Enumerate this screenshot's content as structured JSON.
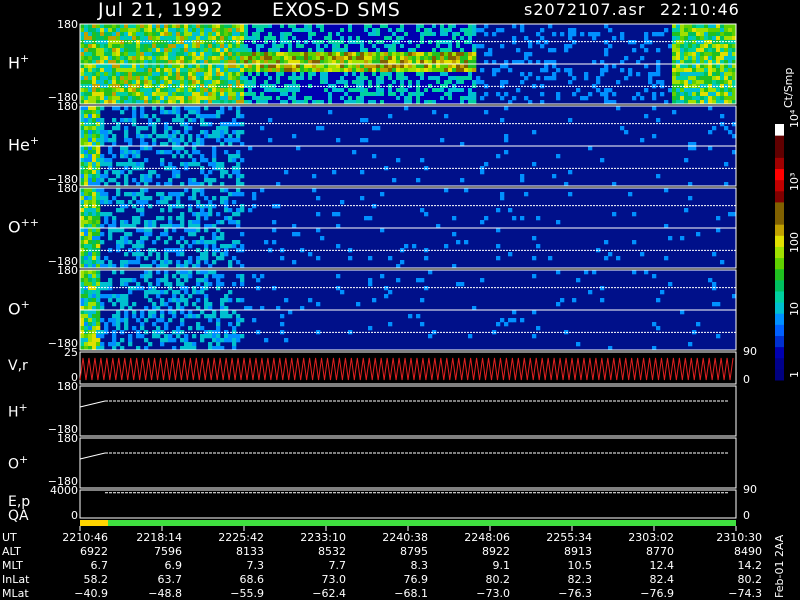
{
  "header": {
    "date": "Jul 21, 1992",
    "mission": "EXOS-D SMS",
    "file": "s2072107.asr",
    "time": "22:10:46"
  },
  "panels": [
    {
      "ion": "H",
      "charge": "+",
      "top": "180",
      "bottom": "−180"
    },
    {
      "ion": "He",
      "charge": "+",
      "top": "180",
      "bottom": "−180"
    },
    {
      "ion": "O",
      "charge": "++",
      "top": "180",
      "bottom": "−180"
    },
    {
      "ion": "O",
      "charge": "+",
      "top": "180",
      "bottom": "−180"
    },
    {
      "ion": "V",
      "charge": ",r",
      "top": "25",
      "bottom": "0",
      "right_top": "90",
      "right_bottom": "0"
    },
    {
      "ion": "H",
      "charge": "+",
      "top": "180",
      "bottom": "−180"
    },
    {
      "ion": "O",
      "charge": "+",
      "top": "180",
      "bottom": "−180"
    },
    {
      "ion": "E,p",
      "charge": "",
      "top": "4000",
      "bottom": "0",
      "right_top": "90"
    },
    {
      "ion": "QA",
      "charge": "",
      "top": "",
      "bottom": "",
      "right_top": "0"
    }
  ],
  "colorbar": {
    "label": "Ct/Smp",
    "ticks": [
      "1",
      "10",
      "100",
      "10³",
      "10⁴"
    ],
    "colors": [
      "#000080",
      "#00008b",
      "#0000b0",
      "#0030d0",
      "#0060ff",
      "#0090ff",
      "#00c0d0",
      "#00d0a0",
      "#00c060",
      "#20c020",
      "#60d000",
      "#a0e000",
      "#e0e000",
      "#c0a000",
      "#806000",
      "#806000",
      "#800000",
      "#c00000",
      "#ff0000",
      "#a00000",
      "#600000",
      "#600000",
      "#ffffff"
    ]
  },
  "footer": {
    "side_label": "Feb-01 2AA",
    "rows": [
      {
        "label": "UT",
        "values": [
          "2210:46",
          "2218:14",
          "2225:42",
          "2233:10",
          "2240:38",
          "2248:06",
          "2255:34",
          "2303:02",
          "2310:30"
        ]
      },
      {
        "label": "ALT",
        "values": [
          "6922",
          "7596",
          "8133",
          "8532",
          "8795",
          "8922",
          "8913",
          "8770",
          "8490"
        ]
      },
      {
        "label": "MLT",
        "values": [
          "6.7",
          "6.9",
          "7.3",
          "7.7",
          "8.3",
          "9.1",
          "10.5",
          "12.4",
          "14.2"
        ]
      },
      {
        "label": "InLat",
        "values": [
          "58.2",
          "63.7",
          "68.6",
          "73.0",
          "76.9",
          "80.2",
          "82.3",
          "82.4",
          "80.2"
        ]
      },
      {
        "label": "MLat",
        "values": [
          "−40.9",
          "−48.8",
          "−55.9",
          "−62.4",
          "−68.1",
          "−73.0",
          "−76.3",
          "−76.9",
          "−74.3"
        ]
      }
    ]
  },
  "chart_data": {
    "type": "heatmap",
    "x_axis_ticks": [
      "2210:46",
      "2218:14",
      "2225:42",
      "2233:10",
      "2240:38",
      "2248:06",
      "2255:34",
      "2303:02",
      "2310:30"
    ],
    "colorbar_label": "Ct/Smp",
    "colorbar_scale": "log",
    "colorbar_range": [
      1,
      10000
    ],
    "spectrograms": [
      {
        "name": "H+",
        "y_range": [
          -180,
          180
        ]
      },
      {
        "name": "He+",
        "y_range": [
          -180,
          180
        ]
      },
      {
        "name": "O++",
        "y_range": [
          -180,
          180
        ]
      },
      {
        "name": "O+",
        "y_range": [
          -180,
          180
        ]
      }
    ],
    "line_panels": [
      {
        "name": "V,r",
        "y_range": [
          0,
          25
        ],
        "right_axis": [
          0,
          90
        ]
      },
      {
        "name": "H+",
        "y_range": [
          -180,
          180
        ]
      },
      {
        "name": "O+",
        "y_range": [
          -180,
          180
        ]
      },
      {
        "name": "E,p",
        "y_range": [
          0,
          4000
        ],
        "right_axis": [
          0,
          90
        ]
      },
      {
        "name": "QA",
        "right_axis": [
          0
        ]
      }
    ]
  }
}
